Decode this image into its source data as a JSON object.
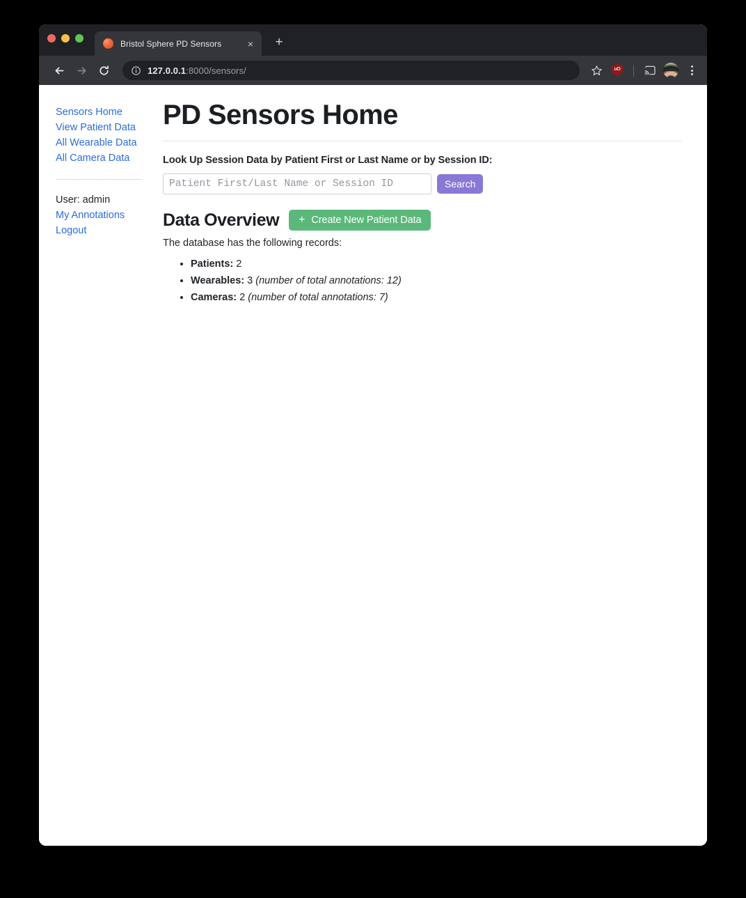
{
  "browser": {
    "tab": {
      "title": "Bristol Sphere PD Sensors",
      "close_label": "×",
      "favicon": "orange-sphere-favicon"
    },
    "new_tab_label": "+",
    "nav": {
      "back": "back-arrow",
      "forward": "forward-arrow",
      "reload": "reload-arrow"
    },
    "omnibox": {
      "site_info_icon": "info-circle-icon",
      "url_host": "127.0.0.1",
      "url_path": ":8000/sensors/"
    },
    "toolbar_icons": {
      "bookmark": "star-icon",
      "extension_label": "uO",
      "extension_name": "ublock-origin-shield-icon",
      "cast": "cast-icon",
      "profile": "profile-avatar",
      "menu": "kebab-menu-icon"
    },
    "traffic_lights": {
      "close": "#ed6a5e",
      "minimize": "#f5bf4f",
      "zoom": "#61c454"
    }
  },
  "sidebar": {
    "nav_links": [
      {
        "label": "Sensors Home"
      },
      {
        "label": "View Patient Data"
      },
      {
        "label": "All Wearable Data"
      },
      {
        "label": "All Camera Data"
      }
    ],
    "user_label": "User: admin",
    "user_links": [
      {
        "label": "My Annotations"
      },
      {
        "label": "Logout"
      }
    ]
  },
  "main": {
    "page_title": "PD Sensors Home",
    "lookup_label": "Look Up Session Data by Patient First or Last Name or by Session ID:",
    "search": {
      "placeholder": "Patient First/Last Name or Session ID",
      "value": "",
      "button_label": "Search"
    },
    "overview": {
      "title": "Data Overview",
      "create_button": {
        "plus": "+",
        "label": "Create New Patient Data"
      },
      "intro": "The database has the following records:",
      "records": [
        {
          "label": "Patients:",
          "count": "2",
          "note": ""
        },
        {
          "label": "Wearables:",
          "count": "3",
          "note": "(number of total annotations: 12)"
        },
        {
          "label": "Cameras:",
          "count": "2",
          "note": "(number of total annotations: 7)"
        }
      ]
    }
  },
  "colors": {
    "link": "#2b6cdf",
    "search_button": "#8a78d6",
    "create_button": "#5cb87a",
    "tab_bar": "#202124",
    "toolbar": "#35363a"
  }
}
